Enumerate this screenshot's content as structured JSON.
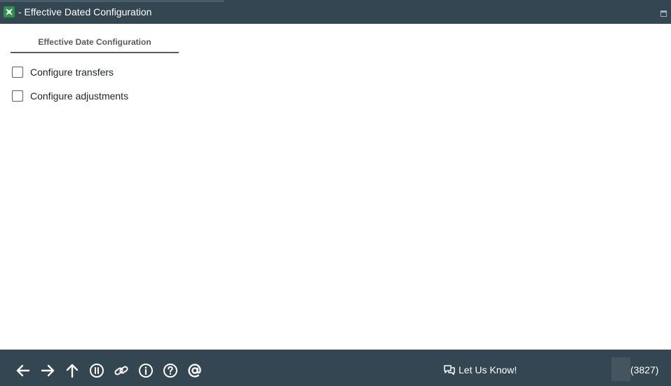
{
  "window": {
    "title": "- Effective Dated Configuration",
    "app_icon": "app-logo-icon",
    "maximize_icon": "maximize-icon"
  },
  "tabs": [
    {
      "label": "Effective Date Configuration",
      "active": true
    }
  ],
  "options": [
    {
      "label": "Configure transfers",
      "checked": false
    },
    {
      "label": "Configure adjustments",
      "checked": false
    }
  ],
  "footer": {
    "nav_icons": [
      "back-arrow-icon",
      "forward-arrow-icon",
      "up-arrow-icon",
      "pause-icon",
      "link-icon",
      "info-icon",
      "help-icon",
      "at-icon"
    ],
    "feedback_label": "Let Us Know!",
    "feedback_icon": "chat-bubbles-icon",
    "count_label": "(3827)"
  },
  "colors": {
    "bar_background": "#344652",
    "tab_underline": "#555d63",
    "content_background": "#ffffff"
  }
}
